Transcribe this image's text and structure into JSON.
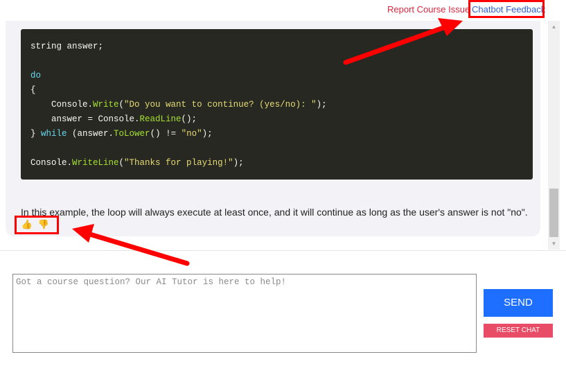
{
  "header": {
    "report_link": "Report Course Issue",
    "feedback_link": "Chatbot Feedback"
  },
  "code": {
    "line1": "string answer;",
    "line2_kw": "do",
    "line3": "{",
    "line4_a": "    Console.",
    "line4_fn": "Write",
    "line4_b": "(",
    "line4_str": "\"Do you want to continue? (yes/no): \"",
    "line4_c": ");",
    "line5_a": "    answer = Console.",
    "line5_fn": "ReadLine",
    "line5_b": "();",
    "line6_a": "} ",
    "line6_kw": "while",
    "line6_b": " (answer.",
    "line6_fn": "ToLower",
    "line6_c": "() != ",
    "line6_str": "\"no\"",
    "line6_d": ");",
    "line7_a": "Console.",
    "line7_fn": "WriteLine",
    "line7_b": "(",
    "line7_str": "\"Thanks for playing!\"",
    "line7_c": ");"
  },
  "message": {
    "explanation": "In this example, the loop will always execute at least once, and it will continue as long as the user's answer is not \"no\".",
    "thumbs_up": "👍",
    "thumbs_down": "👎"
  },
  "composer": {
    "placeholder": "Got a course question? Our AI Tutor is here to help!",
    "value": ""
  },
  "buttons": {
    "send": "SEND",
    "reset": "RESET CHAT"
  },
  "scrollbar": {
    "up": "▲",
    "down": "▼"
  },
  "colors": {
    "send": "#1e6fff",
    "reset": "#e84c66",
    "annotation": "#ff0000",
    "code_bg": "#272822"
  }
}
